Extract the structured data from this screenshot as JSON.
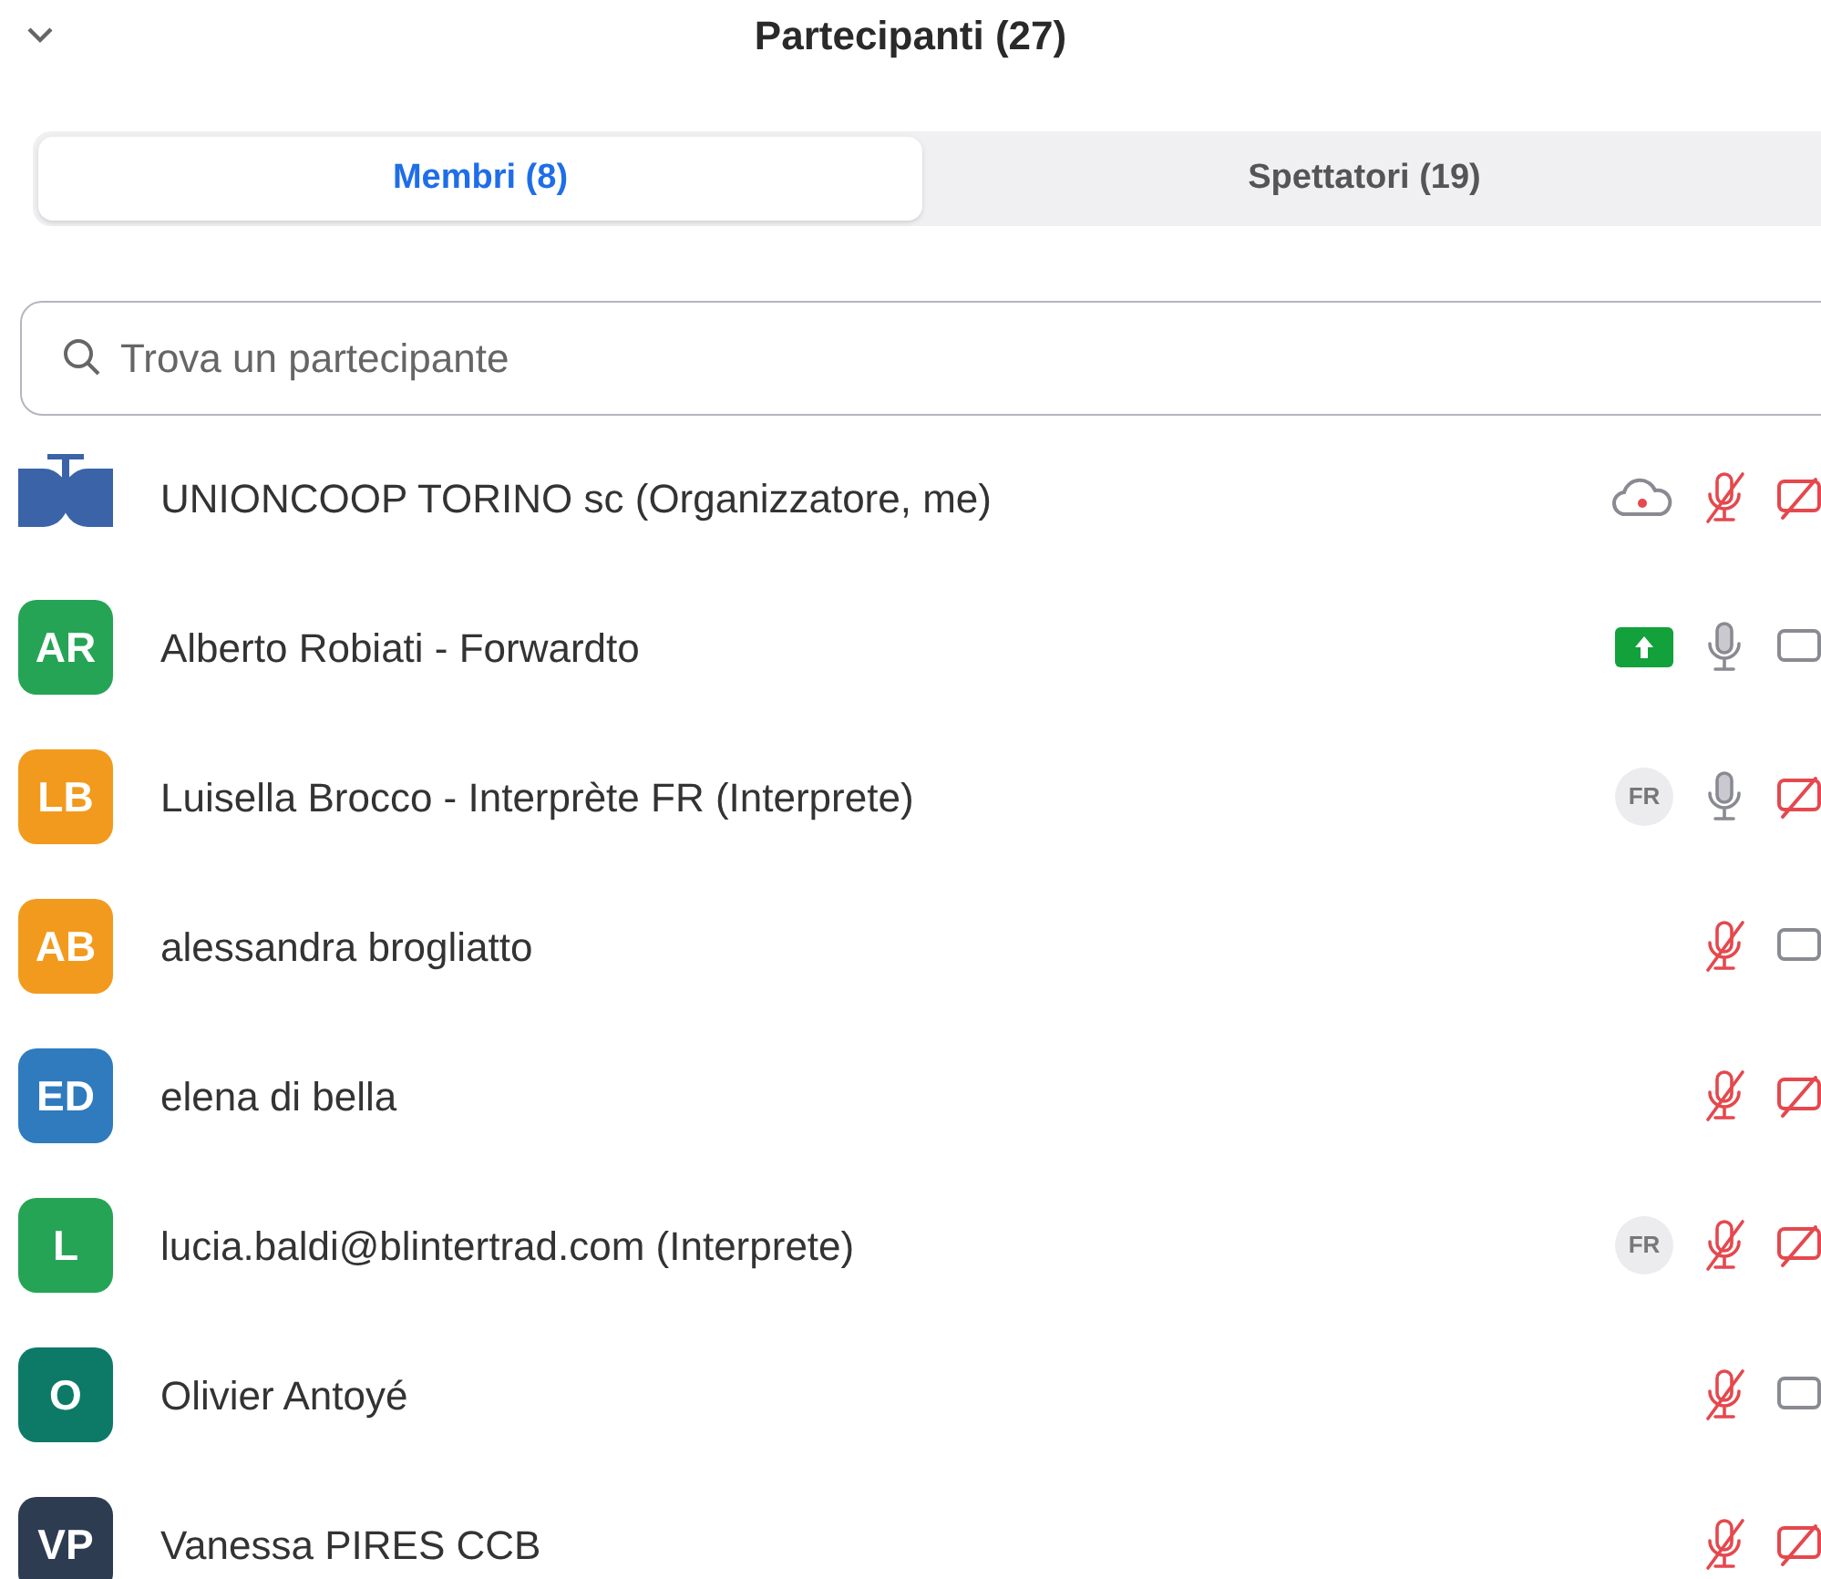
{
  "header": {
    "title": "Partecipanti (27)"
  },
  "tabs": [
    {
      "label": "Membri (8)",
      "selected": true
    },
    {
      "label": "Spettatori (19)",
      "selected": false
    }
  ],
  "search": {
    "placeholder": "Trova un partecipante"
  },
  "participants": [
    {
      "name": "UNIONCOOP TORINO sc (Organizzatore, me)",
      "avatar": {
        "kind": "logo"
      },
      "recording": true,
      "sharing": false,
      "mic_muted": true,
      "video_off": true
    },
    {
      "name": "Alberto Robiati - Forwardto",
      "avatar": {
        "kind": "initials",
        "initials": "AR",
        "color": "#26a455"
      },
      "recording": false,
      "sharing": true,
      "mic_muted": false,
      "video_off": false
    },
    {
      "name": "Luisella Brocco - Interprète FR (Interprete)",
      "avatar": {
        "kind": "initials",
        "initials": "LB",
        "color": "#f29a1d"
      },
      "recording": false,
      "sharing": false,
      "language": "FR",
      "mic_muted": false,
      "video_off": true
    },
    {
      "name": "alessandra brogliatto",
      "avatar": {
        "kind": "initials",
        "initials": "AB",
        "color": "#f29a1d"
      },
      "recording": false,
      "sharing": false,
      "mic_muted": true,
      "video_off": false
    },
    {
      "name": "elena di bella",
      "avatar": {
        "kind": "initials",
        "initials": "ED",
        "color": "#2f7bbd"
      },
      "recording": false,
      "sharing": false,
      "mic_muted": true,
      "video_off": true
    },
    {
      "name": "lucia.baldi@blintertrad.com (Interprete)",
      "avatar": {
        "kind": "initials",
        "initials": "L",
        "color": "#26a455"
      },
      "recording": false,
      "sharing": false,
      "language": "FR",
      "mic_muted": true,
      "video_off": true
    },
    {
      "name": "Olivier Antoyé",
      "avatar": {
        "kind": "initials",
        "initials": "O",
        "color": "#0d7a68"
      },
      "recording": false,
      "sharing": false,
      "mic_muted": true,
      "video_off": false
    },
    {
      "name": "Vanessa PIRES CCB",
      "avatar": {
        "kind": "initials",
        "initials": "VP",
        "color": "#2e3c52"
      },
      "recording": false,
      "sharing": false,
      "mic_muted": true,
      "video_off": true
    }
  ]
}
